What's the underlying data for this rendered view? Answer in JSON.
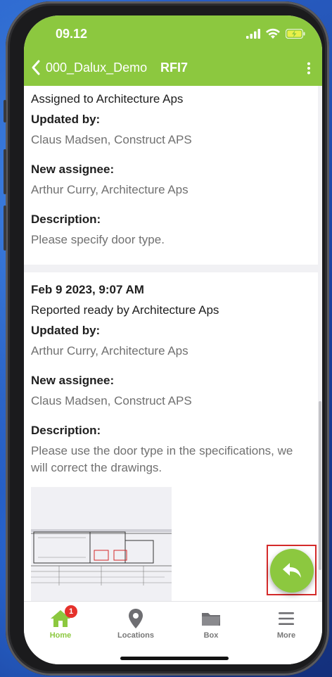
{
  "status_bar": {
    "time": "09.12"
  },
  "nav": {
    "project": "000_Dalux_Demo",
    "item": "RFI7"
  },
  "history": [
    {
      "status_text": "Assigned to Architecture Aps",
      "updated_by_label": "Updated by:",
      "updated_by": "Claus Madsen, Construct APS",
      "new_assignee_label": "New assignee:",
      "new_assignee": "Arthur Curry, Architecture Aps",
      "description_label": "Description:",
      "description": "Please specify door type."
    },
    {
      "date": "Feb 9 2023, 9:07 AM",
      "status_text": "Reported ready by Architecture Aps",
      "updated_by_label": "Updated by:",
      "updated_by": "Arthur Curry, Architecture Aps",
      "new_assignee_label": "New assignee:",
      "new_assignee": "Claus Madsen, Construct APS",
      "description_label": "Description:",
      "description": "Please use the door type in the specifications, we will correct the drawings."
    }
  ],
  "tabs": [
    {
      "label": "Home",
      "icon": "home-icon",
      "badge": "1",
      "active": true
    },
    {
      "label": "Locations",
      "icon": "location-pin-icon"
    },
    {
      "label": "Box",
      "icon": "folder-icon"
    },
    {
      "label": "More",
      "icon": "menu-icon"
    }
  ],
  "colors": {
    "brand_green": "#8cc83f",
    "badge_red": "#e5312b",
    "highlight_red": "#d42a2a"
  }
}
